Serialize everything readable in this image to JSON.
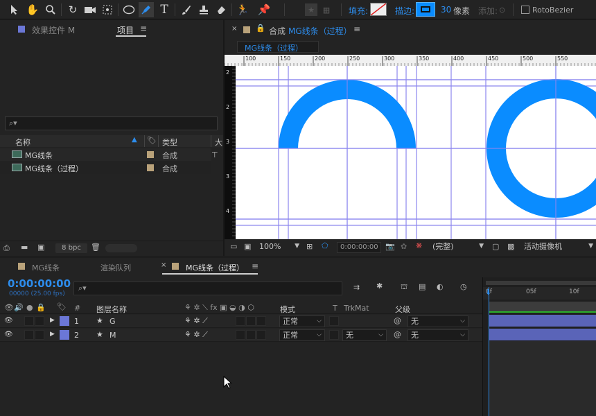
{
  "toolbar": {
    "fill_label": "填充:",
    "stroke_label": "描边:",
    "stroke_width": "30",
    "stroke_unit": "像素",
    "add_label": "添加:",
    "rotobezier_label": "RotoBezier"
  },
  "left_panel": {
    "effects_tab": "效果控件 M",
    "project_tab": "项目",
    "search_placeholder": "",
    "columns": {
      "name": "名称",
      "type": "类型",
      "extra": "大"
    },
    "items": [
      {
        "name": "MG线条",
        "type": "合成"
      },
      {
        "name": "MG线条（过程）",
        "type": "合成"
      }
    ],
    "bpc": "8 bpc"
  },
  "viewer": {
    "tab_prefix": "合成",
    "comp_name": "MG线条（过程）",
    "breadcrumb": "MG线条（过程）",
    "ruler_ticks": [
      "100",
      "150",
      "200",
      "250",
      "300",
      "350",
      "400",
      "450",
      "500",
      "550"
    ],
    "vruler_ticks": [
      "2",
      "2",
      "3",
      "3",
      "4"
    ],
    "zoom": "100%",
    "timecode": "0:00:00:00",
    "resolution": "(完整)",
    "camera": "活动摄像机",
    "shape_color": "#0a8cff"
  },
  "timeline": {
    "tabs": [
      "MG线条",
      "渲染队列",
      "MG线条（过程）"
    ],
    "timecode": "0:00:00:00",
    "fps": "00000 (25.00 fps)",
    "columns": {
      "num": "#",
      "layer_name": "图层名称",
      "mode": "模式",
      "t": "T",
      "trkmat": "TrkMat",
      "parent": "父级"
    },
    "layers": [
      {
        "num": "1",
        "name": "G",
        "mode": "正常",
        "trkmat": "",
        "parent": "无"
      },
      {
        "num": "2",
        "name": "M",
        "mode": "正常",
        "trkmat": "无",
        "parent": "无"
      }
    ],
    "time_ticks": [
      "0f",
      "05f",
      "10f"
    ],
    "layer_color": "#6b77d6",
    "accent": "#2d8ceb"
  }
}
